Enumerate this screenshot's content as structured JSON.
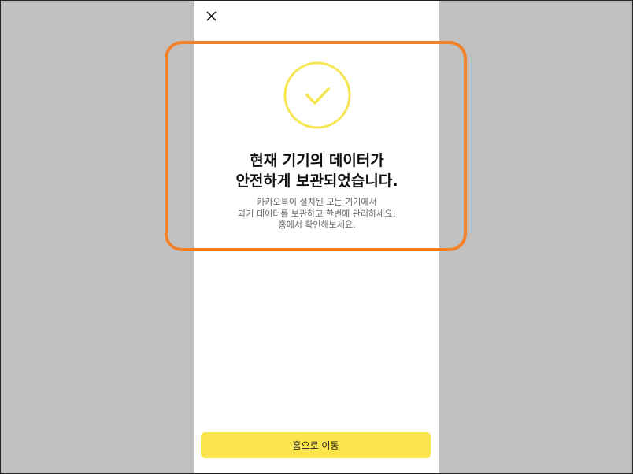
{
  "colors": {
    "background": "#c0c0c0",
    "accent_yellow": "#fae54d",
    "check_yellow": "#f7e653",
    "highlight_orange": "#f3812a"
  },
  "header": {
    "close_icon": "close-icon"
  },
  "status_icon": "check-circle-icon",
  "content": {
    "title_line1": "현재 기기의 데이터가",
    "title_line2": "안전하게 보관되었습니다.",
    "desc_line1": "카카오톡이 설치된 모든 기기에서",
    "desc_line2": "과거 데이터를 보관하고 한번에 관리하세요!",
    "desc_line3": "홈에서 확인해보세요."
  },
  "footer": {
    "home_button_label": "홈으로 이동"
  }
}
